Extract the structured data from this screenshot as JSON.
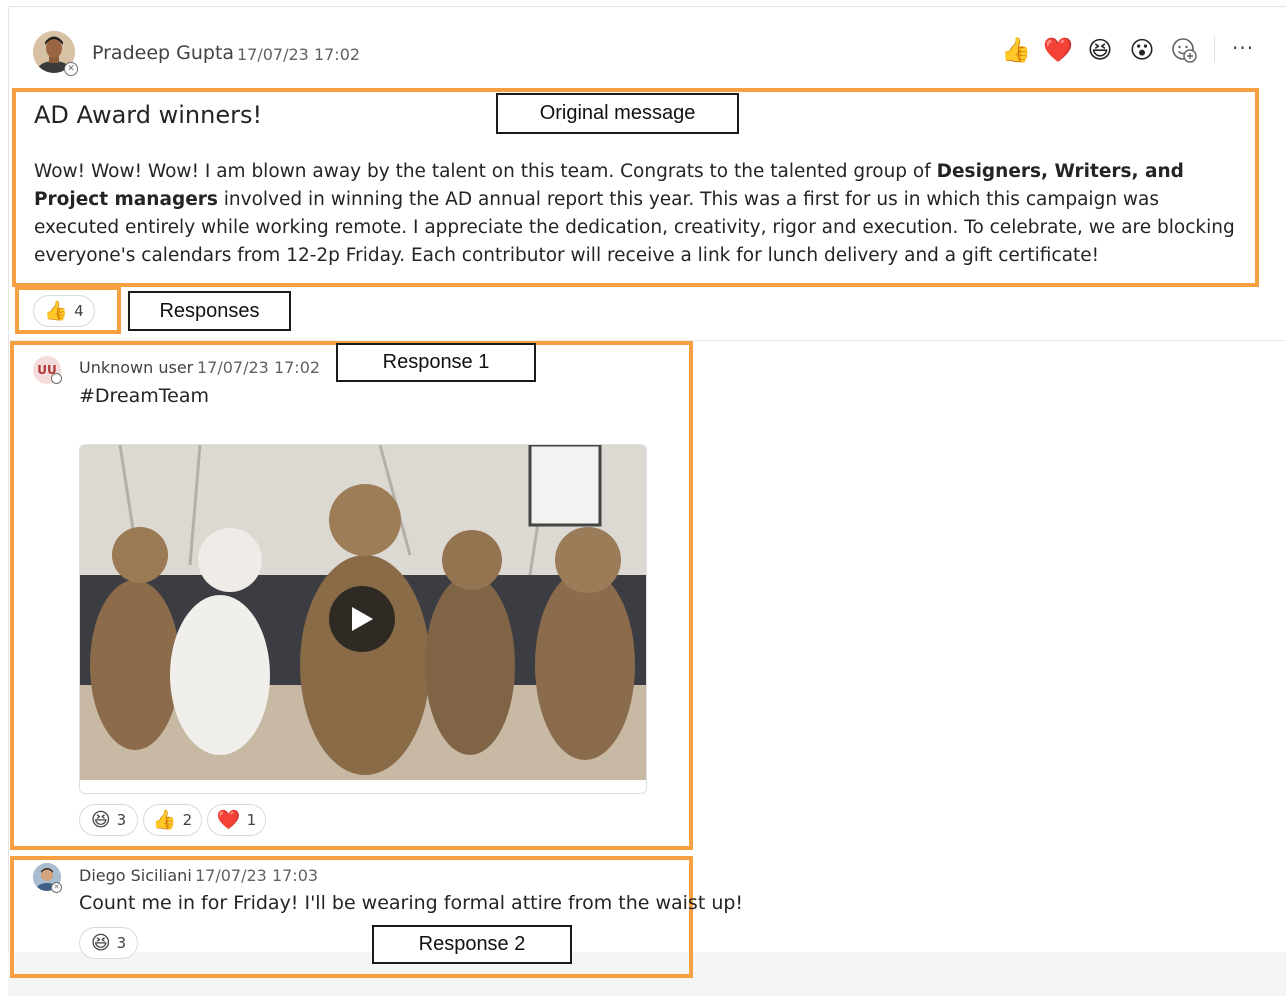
{
  "post": {
    "author": "Pradeep Gupta",
    "timestamp": "17/07/23 17:02",
    "title": "AD Award winners!",
    "body_part1": "Wow! Wow! Wow! I am blown away by the talent on this team. Congrats to the talented group of ",
    "body_bold": "Designers, Writers, and Project managers",
    "body_part2": " involved in winning the AD annual report this year. This was a first for us in which this campaign was executed entirely while working remote. I appreciate the dedication, creativity, rigor and execution. To celebrate, we are blocking everyone's calendars from 12-2p Friday. Each contributor will receive a link for lunch delivery and a gift certificate!",
    "reactions": [
      {
        "icon": "thumbs-up-icon",
        "emoji": "👍",
        "count": "4"
      }
    ]
  },
  "reaction_bar": {
    "items": [
      {
        "name": "like",
        "emoji": "👍"
      },
      {
        "name": "heart",
        "emoji": "❤️"
      },
      {
        "name": "laugh",
        "emoji": "😆"
      },
      {
        "name": "surprised",
        "emoji": "😮"
      }
    ],
    "more_label": "···"
  },
  "annotations": {
    "original_message": "Original message",
    "responses": "Responses",
    "response1": "Response 1",
    "response2": "Response 2"
  },
  "replies": [
    {
      "author": "Unknown user",
      "initials": "UU",
      "timestamp": "17/07/23 17:02",
      "text": "#DreamTeam",
      "reactions": [
        {
          "emoji": "😆",
          "count": "3"
        },
        {
          "emoji": "👍",
          "count": "2"
        },
        {
          "emoji": "❤️",
          "count": "1"
        }
      ]
    },
    {
      "author": "Diego Siciliani",
      "timestamp": "17/07/23 17:03",
      "text": "Count me in for Friday! I'll be wearing formal attire from the waist up!",
      "reactions": [
        {
          "emoji": "😆",
          "count": "3"
        }
      ]
    }
  ],
  "colors": {
    "annotation_orange": "#f7a042"
  }
}
